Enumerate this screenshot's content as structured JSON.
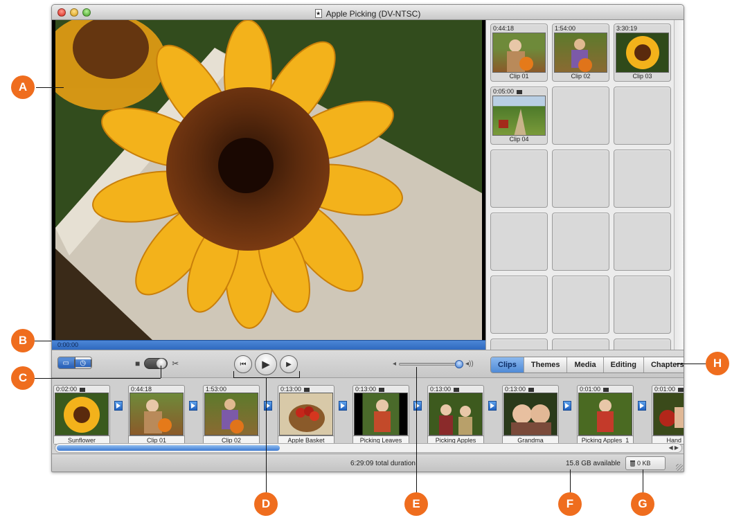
{
  "window": {
    "title": "Apple Picking (DV-NTSC)"
  },
  "viewer": {
    "timecode": "0:00:00"
  },
  "clip_shelf": {
    "clips": [
      {
        "duration": "0:44:18",
        "name": "Clip 01"
      },
      {
        "duration": "1:54:00",
        "name": "Clip 02"
      },
      {
        "duration": "3:30:19",
        "name": "Clip 03"
      },
      {
        "duration": "0:05:00",
        "name": "Clip 04"
      }
    ]
  },
  "controls": {
    "view_toggle": {
      "clip_view_icon": "filmstrip-icon",
      "timeline_view_icon": "clock-icon"
    },
    "mode_switch": {
      "camera_icon": "camera-icon",
      "edit_icon": "scissors-icon"
    },
    "transport": {
      "rewind": "⏮",
      "play": "▶",
      "fullscreen": "▶"
    },
    "volume": {
      "low": "🔈",
      "high": "🔊",
      "level": 1.0
    },
    "panes": [
      "Clips",
      "Themes",
      "Media",
      "Editing",
      "Chapters"
    ],
    "active_pane": "Clips"
  },
  "clip_viewer": {
    "clips": [
      {
        "duration": "0:02:00",
        "name": "Sunflower"
      },
      {
        "duration": "0:44:18",
        "name": "Clip 01"
      },
      {
        "duration": "1:53:00",
        "name": "Clip 02"
      },
      {
        "duration": "0:13:00",
        "name": "Apple Basket"
      },
      {
        "duration": "0:13:00",
        "name": "Picking Leaves"
      },
      {
        "duration": "0:13:00",
        "name": "Picking Apples"
      },
      {
        "duration": "0:13:00",
        "name": "Grandma"
      },
      {
        "duration": "0:01:00",
        "name": "Picking Apples_1"
      },
      {
        "duration": "0:01:00",
        "name": "Hand and"
      }
    ]
  },
  "status": {
    "total_duration": "6:29:09 total duration",
    "available": "15.8 GB available",
    "trash": "0 KB"
  },
  "callouts": [
    "A",
    "B",
    "C",
    "D",
    "E",
    "F",
    "G",
    "H"
  ],
  "colors": {
    "accent": "#ef6d1e",
    "selection_blue": "#4f8ad6"
  }
}
